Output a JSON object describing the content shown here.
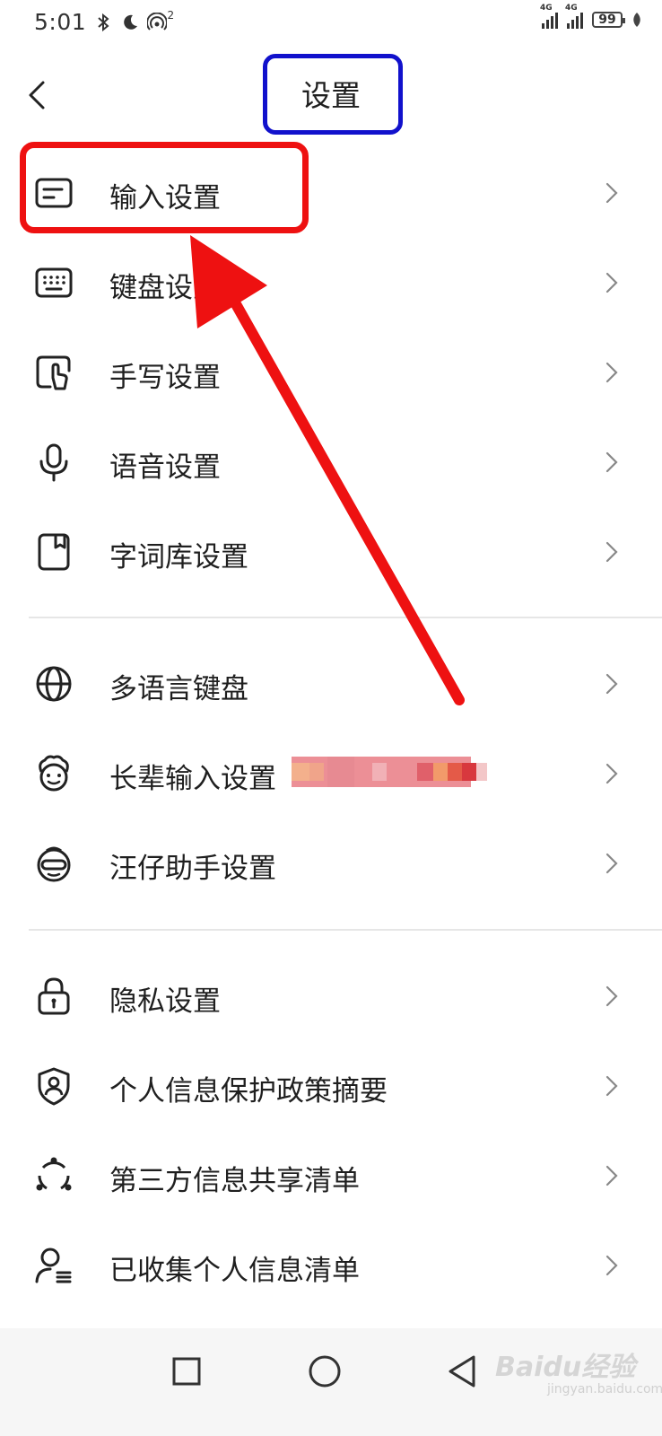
{
  "status_bar": {
    "time": "5:01",
    "hotspot_badge": "2",
    "signal_tag_1": "4G",
    "signal_tag_2": "4G",
    "battery": "99"
  },
  "header": {
    "title": "设置"
  },
  "groups": [
    {
      "items": [
        {
          "label": "输入设置",
          "icon": "keyboard-input-icon"
        },
        {
          "label": "键盘设置",
          "icon": "keyboard-icon"
        },
        {
          "label": "手写设置",
          "icon": "handwriting-icon"
        },
        {
          "label": "语音设置",
          "icon": "microphone-icon"
        },
        {
          "label": "字词库设置",
          "icon": "dictionary-icon"
        }
      ]
    },
    {
      "items": [
        {
          "label": "多语言键盘",
          "icon": "globe-icon"
        },
        {
          "label": "长辈输入设置",
          "icon": "elder-face-icon"
        },
        {
          "label": "汪仔助手设置",
          "icon": "assistant-face-icon"
        }
      ]
    },
    {
      "items": [
        {
          "label": "隐私设置",
          "icon": "lock-icon"
        },
        {
          "label": "个人信息保护政策摘要",
          "icon": "shield-person-icon"
        },
        {
          "label": "第三方信息共享清单",
          "icon": "share-circle-icon"
        },
        {
          "label": "已收集个人信息清单",
          "icon": "person-list-icon"
        }
      ]
    }
  ],
  "watermark": {
    "text": "Baidu经验",
    "sub": "jingyan.baidu.com"
  },
  "colors": {
    "annotation_red": "#ee1111",
    "annotation_blue": "#1111cc"
  }
}
